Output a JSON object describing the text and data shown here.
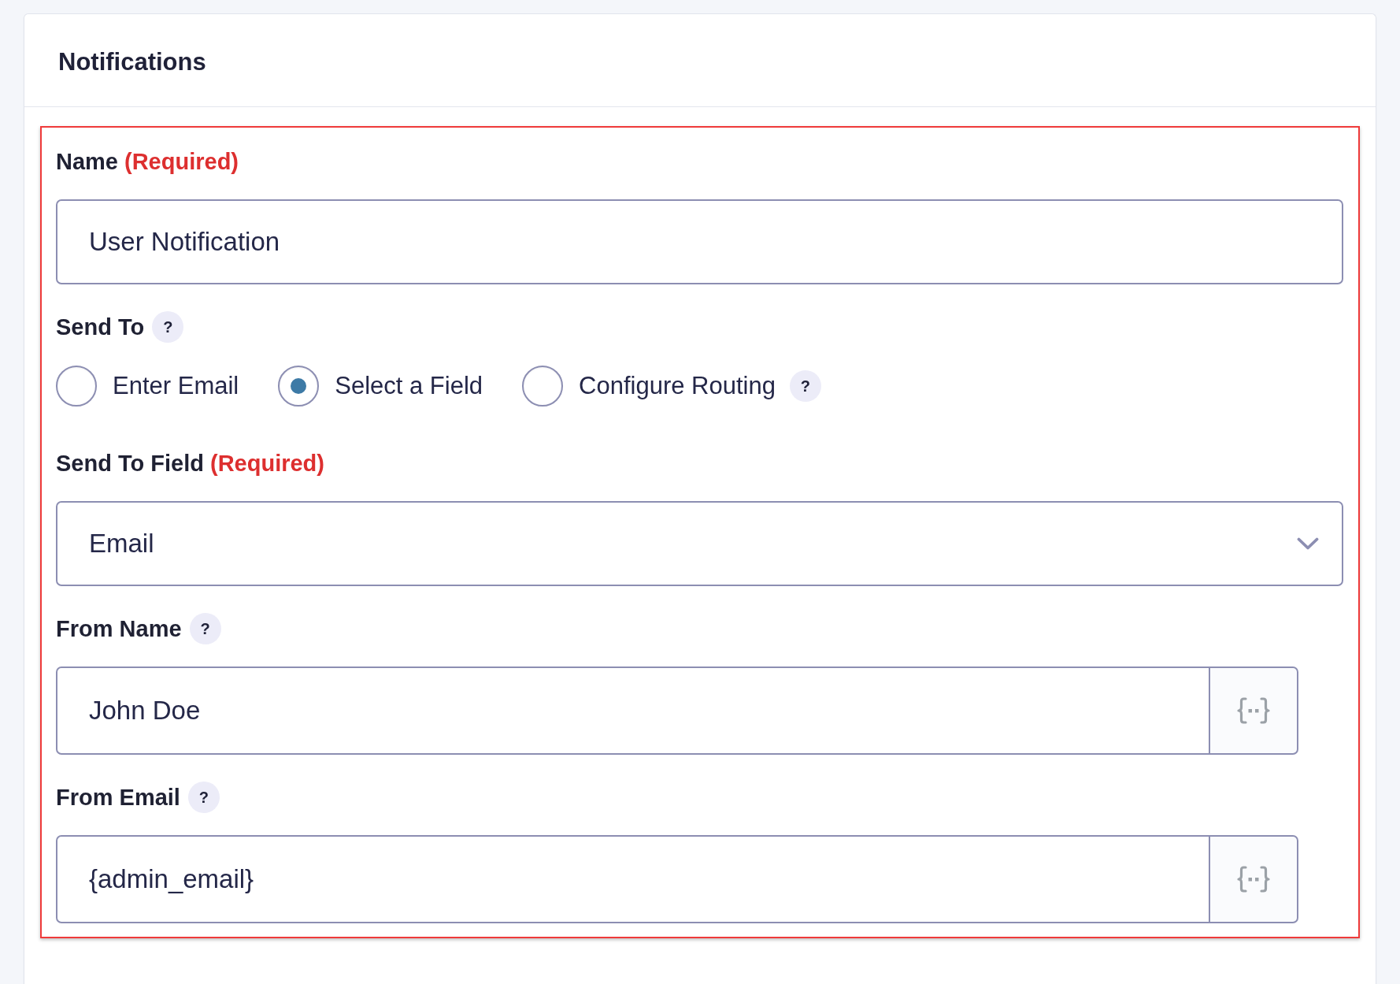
{
  "header": {
    "title": "Notifications"
  },
  "section": {
    "highlighted": true,
    "fields": [
      {
        "kind": "text",
        "label": "Name",
        "required_note": "(Required)",
        "value": "User Notification"
      },
      {
        "kind": "radio",
        "label": "Send To",
        "help": "?",
        "options": [
          {
            "label": "Enter Email",
            "selected": false
          },
          {
            "label": "Select a Field",
            "selected": true
          },
          {
            "label": "Configure Routing",
            "selected": false,
            "help": "?"
          }
        ]
      },
      {
        "kind": "select",
        "label": "Send To Field",
        "required_note": "(Required)",
        "value": "Email"
      },
      {
        "kind": "merge_text",
        "label": "From Name",
        "help": "?",
        "value": "John Doe"
      },
      {
        "kind": "merge_text",
        "label": "From Email",
        "help": "?",
        "value": "{admin_email}"
      }
    ]
  }
}
